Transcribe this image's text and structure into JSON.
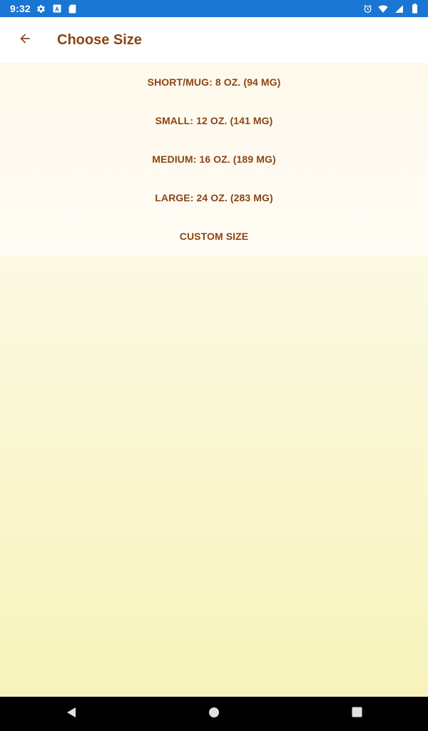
{
  "status_bar": {
    "time": "9:32",
    "left_icons": [
      "settings-icon",
      "font-a-icon",
      "sd-card-icon"
    ],
    "right_icons": [
      "alarm-icon",
      "wifi-icon",
      "signal-icon",
      "battery-icon"
    ],
    "color": "#1976d2"
  },
  "app_bar": {
    "back_icon": "arrow-back-icon",
    "title": "Choose Size",
    "title_color": "#8b4513"
  },
  "sizes": [
    {
      "label": "SHORT/MUG: 8 OZ. (94 MG)"
    },
    {
      "label": "SMALL: 12 OZ. (141 MG)"
    },
    {
      "label": "MEDIUM: 16 OZ. (189 MG)"
    },
    {
      "label": "LARGE: 24 OZ. (283 MG)"
    },
    {
      "label": "CUSTOM SIZE"
    }
  ],
  "nav_bar": {
    "buttons": [
      "back-triangle-icon",
      "home-circle-icon",
      "recents-square-icon"
    ]
  }
}
